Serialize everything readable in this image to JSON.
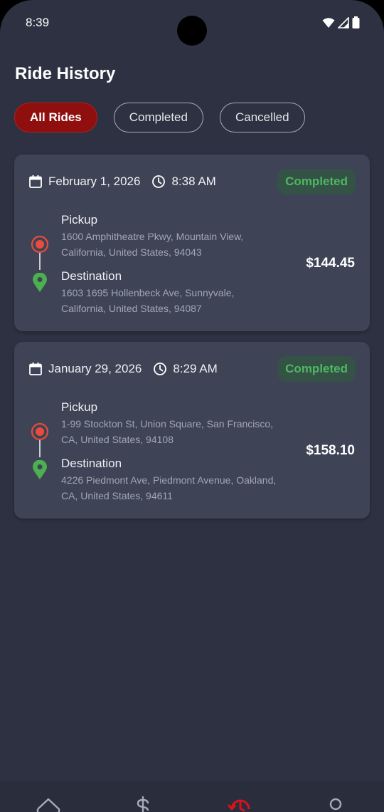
{
  "status": {
    "time": "8:39"
  },
  "page": {
    "title": "Ride History"
  },
  "filters": [
    {
      "label": "All Rides",
      "active": true
    },
    {
      "label": "Completed",
      "active": false
    },
    {
      "label": "Cancelled",
      "active": false
    }
  ],
  "rides": [
    {
      "date": "February 1, 2026",
      "time": "8:38 AM",
      "status": "Completed",
      "pickup_label": "Pickup",
      "pickup_address": "1600 Amphitheatre Pkwy, Mountain View, California, United States, 94043",
      "destination_label": "Destination",
      "destination_address": "1603 1695 Hollenbeck Ave, Sunnyvale, California, United States, 94087",
      "fare": "$144.45"
    },
    {
      "date": "January 29, 2026",
      "time": "8:29 AM",
      "status": "Completed",
      "pickup_label": "Pickup",
      "pickup_address": "1-99 Stockton St, Union Square, San Francisco, CA, United States, 94108",
      "destination_label": "Destination",
      "destination_address": "4226 Piedmont Ave, Piedmont Avenue, Oakland, CA, United States, 94611",
      "fare": "$158.10"
    }
  ],
  "nav": {
    "items": [
      {
        "icon": "home-icon",
        "active": false
      },
      {
        "icon": "dollar-icon",
        "active": false
      },
      {
        "icon": "history-icon",
        "active": true
      },
      {
        "icon": "profile-icon",
        "active": false
      }
    ]
  },
  "colors": {
    "background": "#2e3141",
    "card": "#3e4356",
    "accent_red": "#8f0e0e",
    "status_green": "#4db860",
    "pickup_red": "#e74c3c",
    "destination_green": "#4caf50"
  }
}
